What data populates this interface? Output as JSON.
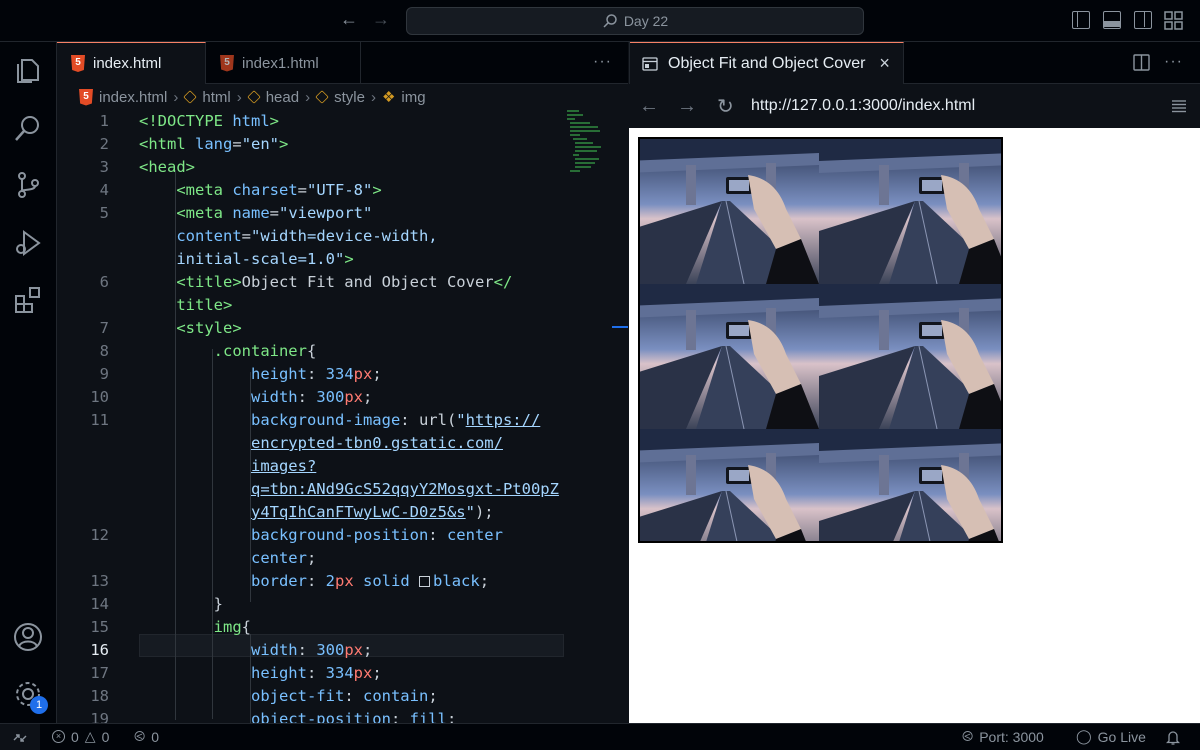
{
  "titlebar": {
    "search_text": "Day 22"
  },
  "activity": {
    "settings_badge": "1"
  },
  "editor": {
    "tabs": [
      {
        "label": "index.html",
        "icon": "html5-icon",
        "active": true
      },
      {
        "label": "index1.html",
        "icon": "html5-icon",
        "active": false
      }
    ],
    "breadcrumb": [
      "index.html",
      "html",
      "head",
      "style",
      "img"
    ],
    "current_line": 16
  },
  "preview": {
    "tab_label": "Object Fit and Object Cover",
    "url": "http://127.0.0.1:3000/index.html"
  },
  "statusbar": {
    "errors": "0",
    "warnings": "0",
    "ports": "0",
    "port_label": "Port: 3000",
    "golive_label": "Go Live"
  },
  "colors": {
    "accent": "#f78166",
    "tag": "#7ee787",
    "attr": "#79c0ff",
    "string": "#a5d6ff",
    "unit": "#ff7b72"
  }
}
